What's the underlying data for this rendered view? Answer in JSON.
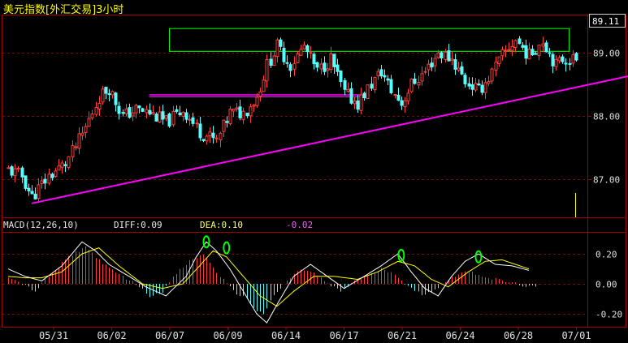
{
  "title": "美元指数[外汇交易]3小时",
  "colors": {
    "up": "#ff3c3c",
    "down": "#54ffff",
    "grid": "#8a0000",
    "axis": "#a00000",
    "trendline": "#ff00ff",
    "box": "#00ff00",
    "diff_line": "#ffffff",
    "dea_line": "#ffff00",
    "marker": "#00ff00"
  },
  "indicator": {
    "name": "MACD(12,26,10)",
    "diff_label": "DIFF:0.09",
    "dea_label": "DEA:0.10",
    "macd_label": "-0.02"
  },
  "chart_data": [
    {
      "type": "candlestick",
      "title": "美元指数[外汇交易]3小时",
      "x_ticks": [
        "05/31",
        "06/02",
        "06/07",
        "06/09",
        "06/14",
        "06/17",
        "06/21",
        "06/24",
        "06/28",
        "07/01"
      ],
      "y_ticks": [
        "87.00",
        "88.00",
        "89.00"
      ],
      "current_price": "89.11",
      "ylim": [
        86.4,
        89.6
      ],
      "price_path": [
        [
          0,
          87.15
        ],
        [
          4,
          87.05
        ],
        [
          7,
          86.72
        ],
        [
          12,
          87.05
        ],
        [
          17,
          87.25
        ],
        [
          22,
          87.7
        ],
        [
          27,
          88.3
        ],
        [
          30,
          88.45
        ],
        [
          34,
          88.0
        ],
        [
          38,
          88.1
        ],
        [
          42,
          88.05
        ],
        [
          47,
          87.9
        ],
        [
          52,
          88.1
        ],
        [
          57,
          87.75
        ],
        [
          62,
          87.6
        ],
        [
          66,
          88.05
        ],
        [
          70,
          88.05
        ],
        [
          74,
          88.3
        ],
        [
          77,
          88.8
        ],
        [
          80,
          89.1
        ],
        [
          84,
          88.8
        ],
        [
          88,
          89.1
        ],
        [
          92,
          88.7
        ],
        [
          96,
          88.9
        ],
        [
          100,
          88.35
        ],
        [
          104,
          88.2
        ],
        [
          108,
          88.5
        ],
        [
          111,
          88.7
        ],
        [
          114,
          88.4
        ],
        [
          117,
          88.2
        ],
        [
          120,
          88.5
        ],
        [
          124,
          88.7
        ],
        [
          128,
          89.0
        ],
        [
          132,
          88.9
        ],
        [
          136,
          88.55
        ],
        [
          140,
          88.4
        ],
        [
          143,
          88.6
        ],
        [
          147,
          88.95
        ],
        [
          151,
          89.2
        ],
        [
          155,
          88.95
        ],
        [
          159,
          89.2
        ],
        [
          163,
          88.8
        ],
        [
          165,
          88.9
        ]
      ],
      "annotations": {
        "trendline": {
          "from": [
            7,
            86.62
          ],
          "to": [
            175,
            88.55
          ]
        },
        "resistance_line": {
          "from": [
            42,
            88.32
          ],
          "to": [
            105,
            88.32
          ],
          "value": 88.32
        },
        "box": {
          "x": [
            48,
            167
          ],
          "y": [
            89.02,
            89.38
          ]
        }
      }
    },
    {
      "type": "bar",
      "title": "MACD(12,26,10)",
      "y_ticks": [
        "0.20",
        "0.00",
        "-0.20"
      ],
      "ylim": [
        -0.27,
        0.33
      ],
      "macd_path": [
        [
          0,
          0.05
        ],
        [
          4,
          0.0
        ],
        [
          8,
          -0.05
        ],
        [
          12,
          0.05
        ],
        [
          18,
          0.18
        ],
        [
          23,
          0.25
        ],
        [
          26,
          0.18
        ],
        [
          30,
          0.1
        ],
        [
          34,
          0.05
        ],
        [
          38,
          0.0
        ],
        [
          42,
          -0.08
        ],
        [
          46,
          -0.05
        ],
        [
          50,
          0.07
        ],
        [
          54,
          0.15
        ],
        [
          58,
          0.2
        ],
        [
          60,
          0.14
        ],
        [
          63,
          0.05
        ],
        [
          67,
          -0.05
        ],
        [
          71,
          -0.1
        ],
        [
          74,
          -0.18
        ],
        [
          76,
          -0.2
        ],
        [
          79,
          -0.08
        ],
        [
          83,
          0.02
        ],
        [
          87,
          0.1
        ],
        [
          91,
          0.07
        ],
        [
          95,
          0.0
        ],
        [
          99,
          -0.05
        ],
        [
          103,
          0.02
        ],
        [
          107,
          0.05
        ],
        [
          111,
          0.1
        ],
        [
          115,
          0.07
        ],
        [
          119,
          -0.02
        ],
        [
          123,
          -0.07
        ],
        [
          127,
          -0.04
        ],
        [
          131,
          0.03
        ],
        [
          135,
          0.08
        ],
        [
          139,
          0.07
        ],
        [
          143,
          0.04
        ],
        [
          147,
          0.02
        ],
        [
          151,
          0.0
        ],
        [
          155,
          -0.02
        ]
      ],
      "diff_path": [
        [
          0,
          0.1
        ],
        [
          5,
          0.05
        ],
        [
          10,
          0.02
        ],
        [
          16,
          0.12
        ],
        [
          22,
          0.28
        ],
        [
          26,
          0.22
        ],
        [
          30,
          0.13
        ],
        [
          36,
          0.05
        ],
        [
          41,
          -0.02
        ],
        [
          47,
          -0.08
        ],
        [
          53,
          0.05
        ],
        [
          56,
          0.18
        ],
        [
          59,
          0.28
        ],
        [
          62,
          0.22
        ],
        [
          66,
          0.1
        ],
        [
          70,
          -0.05
        ],
        [
          74,
          -0.2
        ],
        [
          77,
          -0.26
        ],
        [
          81,
          -0.1
        ],
        [
          85,
          0.05
        ],
        [
          90,
          0.13
        ],
        [
          95,
          0.05
        ],
        [
          100,
          -0.03
        ],
        [
          106,
          0.05
        ],
        [
          111,
          0.12
        ],
        [
          116,
          0.2
        ],
        [
          120,
          0.08
        ],
        [
          124,
          -0.03
        ],
        [
          128,
          -0.08
        ],
        [
          132,
          0.05
        ],
        [
          136,
          0.15
        ],
        [
          140,
          0.2
        ],
        [
          145,
          0.13
        ],
        [
          150,
          0.12
        ],
        [
          155,
          0.09
        ]
      ],
      "dea_path": [
        [
          0,
          0.05
        ],
        [
          5,
          0.04
        ],
        [
          10,
          0.04
        ],
        [
          16,
          0.08
        ],
        [
          22,
          0.2
        ],
        [
          27,
          0.24
        ],
        [
          33,
          0.12
        ],
        [
          40,
          0.0
        ],
        [
          46,
          -0.03
        ],
        [
          52,
          0.0
        ],
        [
          57,
          0.12
        ],
        [
          61,
          0.22
        ],
        [
          65,
          0.18
        ],
        [
          70,
          0.05
        ],
        [
          75,
          -0.08
        ],
        [
          80,
          -0.15
        ],
        [
          85,
          -0.05
        ],
        [
          91,
          0.05
        ],
        [
          97,
          0.05
        ],
        [
          104,
          0.03
        ],
        [
          110,
          0.08
        ],
        [
          116,
          0.15
        ],
        [
          121,
          0.12
        ],
        [
          126,
          0.03
        ],
        [
          131,
          -0.02
        ],
        [
          137,
          0.08
        ],
        [
          142,
          0.15
        ],
        [
          147,
          0.16
        ],
        [
          151,
          0.13
        ],
        [
          155,
          0.1
        ]
      ],
      "markers": [
        {
          "x": 59,
          "y": 0.28
        },
        {
          "x": 65,
          "y": 0.24
        },
        {
          "x": 117,
          "y": 0.19
        },
        {
          "x": 140,
          "y": 0.18
        }
      ]
    }
  ]
}
